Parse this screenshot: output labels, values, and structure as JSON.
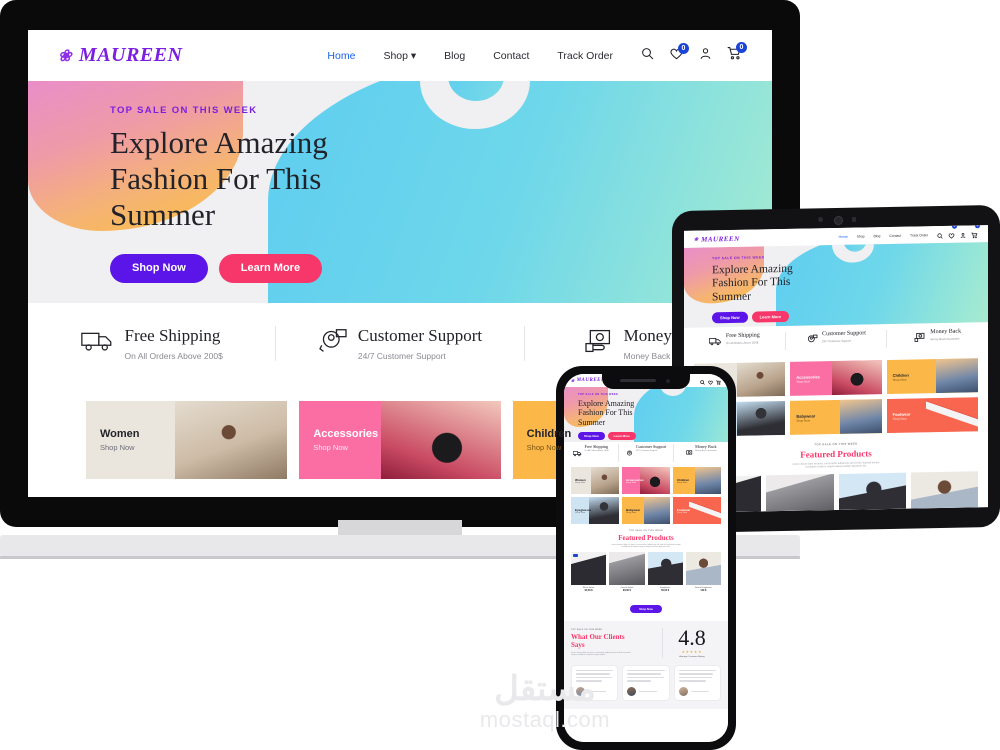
{
  "site": {
    "brand": "MAUREEN",
    "brand_icon": "flower-icon",
    "nav": {
      "links": [
        {
          "label": "Home",
          "active": true
        },
        {
          "label": "Shop",
          "active": false,
          "caret": "⌄"
        },
        {
          "label": "Blog",
          "active": false
        },
        {
          "label": "Contact",
          "active": false
        },
        {
          "label": "Track Order",
          "active": false
        }
      ],
      "icons": [
        {
          "name": "search-icon",
          "glyph": "⌕",
          "badge": null
        },
        {
          "name": "wishlist-heart-icon",
          "glyph": "♡",
          "badge": "0"
        },
        {
          "name": "account-user-icon",
          "glyph": "⚹",
          "badge": null
        },
        {
          "name": "cart-icon",
          "glyph": "Ὥ2",
          "badge": "0"
        }
      ]
    },
    "hero": {
      "eyebrow": "TOP SALE ON THIS WEEK",
      "title_line1": "Explore Amazing",
      "title_line2": "Fashion For This",
      "title_line3": "Summer",
      "primary_button": "Shop Now",
      "secondary_button": "Learn More"
    },
    "features": [
      {
        "icon": "delivery-truck-icon",
        "title": "Free Shipping",
        "sub": "On All Orders Above 200$"
      },
      {
        "icon": "headset-support-icon",
        "title": "Customer Support",
        "sub": "24/7 Customer Support"
      },
      {
        "icon": "money-hand-icon",
        "title": "Money Back",
        "sub": "Money Back Guarantee"
      }
    ],
    "categories": [
      {
        "title": "Women",
        "sub": "Shop Now",
        "bg": "#ebe6dd",
        "photo": "woman-sunglasses"
      },
      {
        "title": "Accessories",
        "sub": "Shop Now",
        "bg": "#fb6ea3",
        "photo": "headphones"
      },
      {
        "title": "Children",
        "sub": "Shop Now",
        "bg": "#fbb849",
        "photo": "girl-denim"
      },
      {
        "title": "Eyeglasses",
        "sub": "Shop Now",
        "bg": "#cfe4f2",
        "photo": "man-sunglasses"
      },
      {
        "title": "Babywear",
        "sub": "Shop Now",
        "bg": "#fbb849",
        "photo": "girl-denim-2"
      },
      {
        "title": "Footwear",
        "sub": "Shop Now",
        "bg": "#f9664f",
        "photo": "red-sneaker"
      }
    ],
    "featured": {
      "eyebrow": "TOP SALE ON THIS WEEK",
      "title": "Featured Products",
      "desc_line1": "Lorem ipsum dolor sit amet, consectetur adipiscing elit sed do eiusmod tempor",
      "desc_line2": "incididunt ut labore magna aliqua partiam dignissim dis.",
      "button": "Shop Now",
      "products": [
        {
          "name": "Black Jacket",
          "old_price": "180,00 $",
          "price": "90,00 $",
          "bg": "#f1f1f1"
        },
        {
          "name": "Casual Jacket",
          "price": "96,00 $",
          "bg": "#eceaea"
        },
        {
          "name": "Sunglasses",
          "price": "56,00 $",
          "bg": "#d4e7f5"
        },
        {
          "name": "Round Sunglasses",
          "price": "149 $",
          "bg": "#ece8e2"
        }
      ]
    },
    "testimonials": {
      "eyebrow": "TOP SALE ON THIS WEEK",
      "title_line1": "What Our Clients",
      "title_line2": "Says",
      "desc_line1": "Lorem ipsum dolor sit amet, consectetur adipiscing elit sed do eiusmod",
      "desc_line2": "tempor incididunt ut labore magna aliqua.",
      "rating_value": "4.8",
      "rating_stars": "★★★★★",
      "rating_label": "Average Customer Rating",
      "cards": [
        {
          "author": "Jane Doe"
        },
        {
          "author": "John Roe"
        },
        {
          "author": "Amy Lee"
        }
      ]
    }
  },
  "watermark": {
    "arabic": "مستقل",
    "latin": "mostaql.com"
  },
  "colors": {
    "brand_purple": "#7b1fe0",
    "button_purple": "#5b15e8",
    "button_pink": "#f7376a",
    "nav_active_blue": "#1a62e8",
    "badge_blue": "#1a43d8",
    "hero_bg": "#f0eff1",
    "star_orange": "#f5a623"
  }
}
